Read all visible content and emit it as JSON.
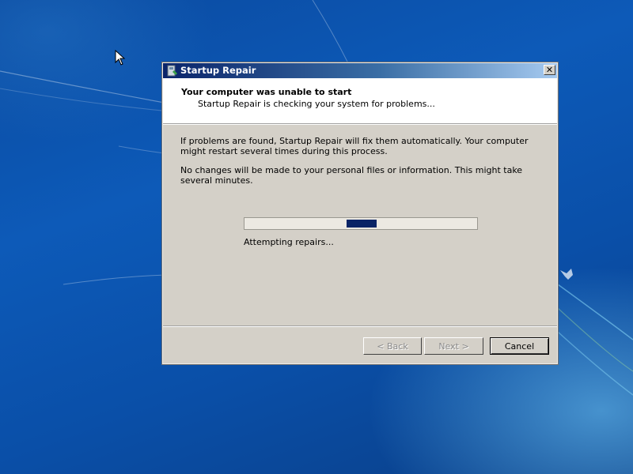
{
  "window": {
    "title": "Startup Repair",
    "close_glyph": "✕"
  },
  "header": {
    "title": "Your computer was unable to start",
    "subtitle": "Startup Repair is checking your system for problems..."
  },
  "body": {
    "paragraph1": "If problems are found, Startup Repair will fix them automatically. Your computer might restart several times during this process.",
    "paragraph2": "No changes will be made to your personal files or information. This might take several minutes."
  },
  "progress": {
    "label": "Attempting repairs...",
    "indeterminate": true,
    "segment_start_fraction": 0.44,
    "segment_end_fraction": 0.57,
    "fill_color": "#0a2466"
  },
  "buttons": {
    "back_label": "< Back",
    "next_label": "Next >",
    "cancel_label": "Cancel"
  },
  "icons": {
    "app_icon": "startup-repair-icon",
    "cursor": "mouse-pointer-icon"
  },
  "colors": {
    "titlebar_start": "#0a246a",
    "titlebar_end": "#a6caf0",
    "desktop": "#0d5ab8"
  }
}
